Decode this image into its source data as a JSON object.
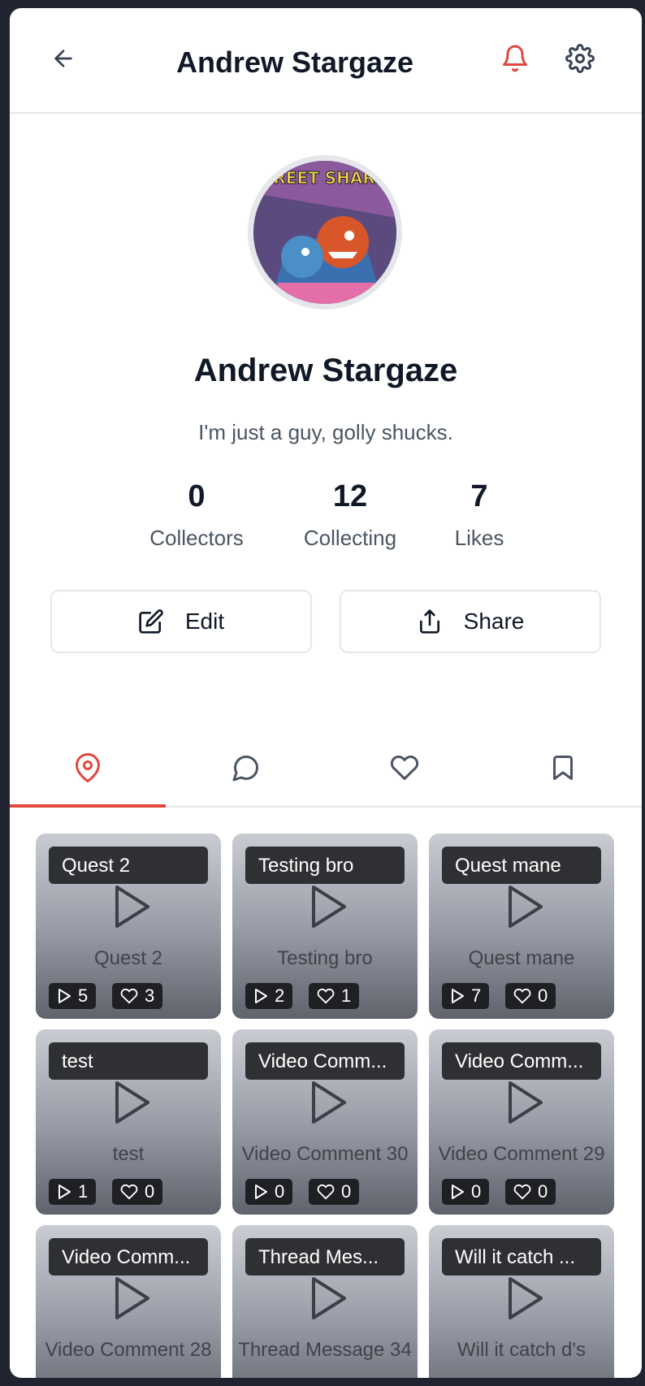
{
  "header": {
    "title": "Andrew Stargaze",
    "back_icon": "arrow-left-icon",
    "bell_icon": "bell-icon",
    "settings_icon": "gear-icon",
    "bell_color": "#e0483f"
  },
  "profile": {
    "avatar_art_text": "STREET SHARKS",
    "name": "Andrew Stargaze",
    "bio": "I'm just a guy, golly shucks.",
    "stats": [
      {
        "value": "0",
        "label": "Collectors"
      },
      {
        "value": "12",
        "label": "Collecting"
      },
      {
        "value": "7",
        "label": "Likes"
      }
    ]
  },
  "actions": {
    "edit_label": "Edit",
    "share_label": "Share"
  },
  "tabs": [
    {
      "icon": "map-pin-icon",
      "active": true
    },
    {
      "icon": "chat-bubble-icon",
      "active": false
    },
    {
      "icon": "heart-icon",
      "active": false
    },
    {
      "icon": "bookmark-icon",
      "active": false
    }
  ],
  "accent_color": "#e0483f",
  "cards": [
    {
      "title": "Quest 2",
      "caption": "Quest 2",
      "plays": "5",
      "likes": "3"
    },
    {
      "title": "Testing bro",
      "caption": "Testing bro",
      "plays": "2",
      "likes": "1"
    },
    {
      "title": "Quest mane",
      "caption": "Quest mane",
      "plays": "7",
      "likes": "0"
    },
    {
      "title": "test",
      "caption": "test",
      "plays": "1",
      "likes": "0"
    },
    {
      "title": "Video Comm...",
      "caption": "Video Comment 30",
      "plays": "0",
      "likes": "0"
    },
    {
      "title": "Video Comm...",
      "caption": "Video Comment 29",
      "plays": "0",
      "likes": "0"
    },
    {
      "title": "Video Comm...",
      "caption": "Video Comment 28",
      "plays": "",
      "likes": ""
    },
    {
      "title": "Thread Mes...",
      "caption": "Thread Message 34",
      "plays": "",
      "likes": ""
    },
    {
      "title": "Will it catch ...",
      "caption": "Will it catch d's",
      "plays": "",
      "likes": ""
    }
  ]
}
